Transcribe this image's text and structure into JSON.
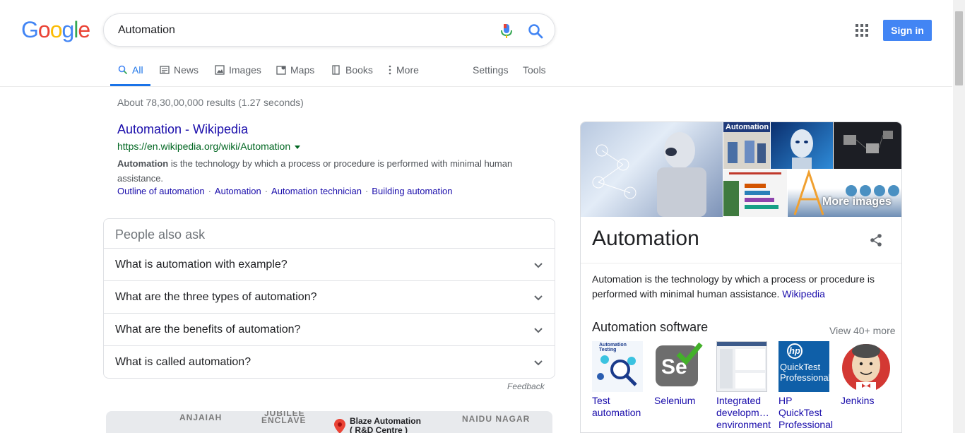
{
  "header": {
    "logo_text": "Google",
    "search_value": "Automation",
    "signin_label": "Sign in"
  },
  "tabs": {
    "all": "All",
    "news": "News",
    "images": "Images",
    "maps": "Maps",
    "books": "Books",
    "more": "More",
    "settings": "Settings",
    "tools": "Tools"
  },
  "results": {
    "stats": "About 78,30,00,000 results (1.27 seconds)",
    "first": {
      "title": "Automation - Wikipedia",
      "url": "https://en.wikipedia.org/wiki/Automation",
      "snippet_bold": "Automation",
      "snippet_rest": " is the technology by which a process or procedure is performed with minimal human assistance.",
      "sitelinks": [
        "Outline of automation",
        "Automation",
        "Automation technician",
        "Building automation"
      ]
    }
  },
  "paa": {
    "heading": "People also ask",
    "questions": [
      "What is automation with example?",
      "What are the three types of automation?",
      "What are the benefits of automation?",
      "What is called automation?"
    ],
    "feedback": "Feedback"
  },
  "map": {
    "labels": [
      "ANJAIAH",
      "JUBILEE",
      "ENCLAVE",
      "NAIDU NAGAR"
    ],
    "place_line1": "Blaze Automation",
    "place_line2": "( R&D Centre )"
  },
  "knowledge_panel": {
    "title": "Automation",
    "image_label_1": "Automation",
    "more_images": "More images",
    "description": "Automation is the technology by which a process or procedure is performed with minimal human assistance.",
    "source_link": "Wikipedia",
    "software_heading": "Automation software",
    "view_more": "View 40+ more",
    "software": [
      {
        "line1": "Test",
        "line2": "automation",
        "line3": ""
      },
      {
        "line1": "Selenium",
        "line2": "",
        "line3": ""
      },
      {
        "line1": "Integrated",
        "line2": "developm…",
        "line3": "environment"
      },
      {
        "line1": "HP",
        "line2": "QuickTest",
        "line3": "Professional"
      },
      {
        "line1": "Jenkins",
        "line2": "",
        "line3": ""
      }
    ],
    "hp_logo_text": "hp",
    "hp_logo_line1": "QuickTest",
    "hp_logo_line2": "Professional",
    "se_logo_text": "Se",
    "test_img_text": "Automation Testing"
  },
  "colors": {
    "link": "#1a0dab",
    "url": "#006621",
    "accent": "#1a73e8",
    "signin": "#4285f4"
  }
}
